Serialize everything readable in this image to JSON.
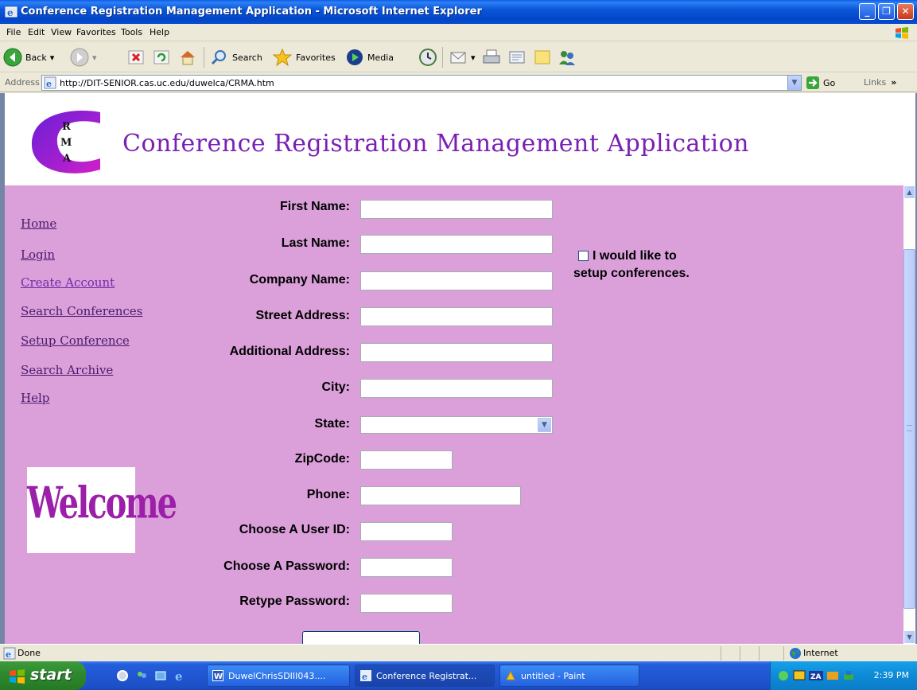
{
  "window": {
    "title": "Conference Registration Management Application - Microsoft Internet Explorer"
  },
  "menu": [
    "File",
    "Edit",
    "View",
    "Favorites",
    "Tools",
    "Help"
  ],
  "toolbar": {
    "back": "Back",
    "search": "Search",
    "favorites": "Favorites",
    "media": "Media"
  },
  "address": {
    "label": "Address",
    "url": "http://DIT-SENIOR.cas.uc.edu/duwelca/CRMA.htm",
    "go": "Go",
    "links": "Links"
  },
  "page": {
    "logo_letters": [
      "R",
      "M",
      "A"
    ],
    "title": "Conference Registration Management Application",
    "nav": [
      {
        "label": "Home"
      },
      {
        "label": "Login"
      },
      {
        "label": "Create Account"
      },
      {
        "label": "Search Conferences"
      },
      {
        "label": "Setup Conference"
      },
      {
        "label": "Search Archive"
      },
      {
        "label": "Help"
      }
    ],
    "welcome": "Welcome",
    "form": {
      "first_name": "First Name:",
      "last_name": "Last Name:",
      "company_name": "Company Name:",
      "street_address": "Street Address:",
      "additional_address": "Additional Address:",
      "city": "City:",
      "state": "State:",
      "zipcode": "ZipCode:",
      "phone": "Phone:",
      "user_id": "Choose A User ID:",
      "password": "Choose A Password:",
      "retype_password": "Retype Password:"
    },
    "setup_checkbox": {
      "line1": "I would like to",
      "line2": "setup conferences.",
      "checked": false
    }
  },
  "status": {
    "text": "Done",
    "zone": "Internet"
  },
  "taskbar": {
    "start": "start",
    "tasks": [
      {
        "label": "DuwelChrisSDIII043...."
      },
      {
        "label": "Conference Registrat..."
      },
      {
        "label": "untitled - Paint"
      }
    ],
    "clock": "2:39 PM"
  },
  "colors": {
    "page_bg": "#dba0da",
    "title_purple": "#7a1fb3",
    "link_color": "#4a1b6b",
    "xp_blue": "#0a56d8"
  }
}
